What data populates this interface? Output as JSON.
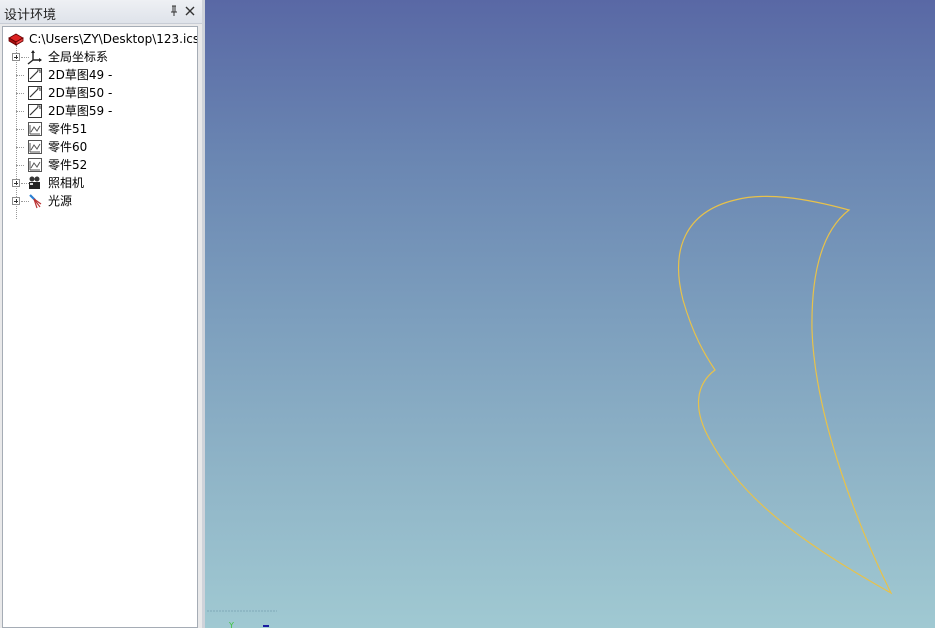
{
  "panel": {
    "title": "设计环境",
    "pin_glyph": "ㅁ",
    "close_glyph": "✕"
  },
  "tree": {
    "root_label": "C:\\Users\\ZY\\Desktop\\123.ics",
    "items": [
      {
        "label": "全局坐标系",
        "icon": "axes-icon"
      },
      {
        "label": "2D草图49 -",
        "icon": "sketch-icon"
      },
      {
        "label": "2D草图50 -",
        "icon": "sketch-icon"
      },
      {
        "label": "2D草图59 -",
        "icon": "sketch-icon"
      },
      {
        "label": "零件51",
        "icon": "part-icon"
      },
      {
        "label": "零件60",
        "icon": "part-icon"
      },
      {
        "label": "零件52",
        "icon": "part-icon"
      },
      {
        "label": "照相机",
        "icon": "camera-icon"
      },
      {
        "label": "光源",
        "icon": "light-icon"
      }
    ]
  },
  "viewport": {
    "curve_color": "#e8c24a",
    "bg_top": "#5968a5",
    "bg_bottom": "#a0c9d2",
    "axis_label_y": "Y"
  }
}
